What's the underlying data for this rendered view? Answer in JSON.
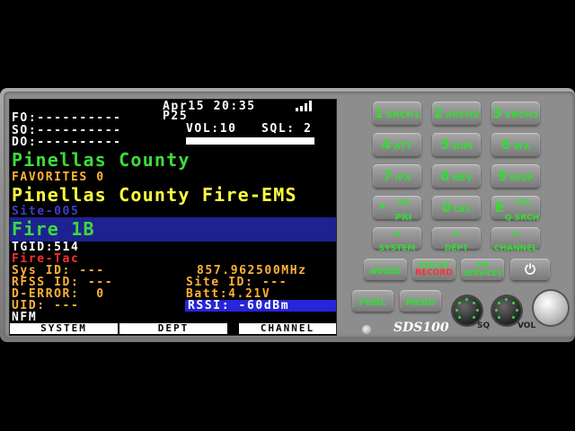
{
  "device": {
    "brand": "SDS100"
  },
  "status": {
    "date": "Apr15",
    "time": "20:35",
    "mode": "P25",
    "fo": "FO:----------",
    "so": "SO:----------",
    "do": "DO:----------",
    "volume": "VOL:10",
    "squelch": "SQL: 2"
  },
  "scan": {
    "system": "Pinellas County",
    "favorites": "FAVORITES 0",
    "department": "Pinellas County Fire-EMS",
    "site": "Site-005",
    "channel": "Fire 1B",
    "tgid": "TGID:514",
    "service_type": "Fire-Tac"
  },
  "details": {
    "sys_id": "Sys ID: ---",
    "frequency": "857.962500MHz",
    "rfss_id": "RFSS ID: ---",
    "site_id": "Site ID: ---",
    "d_error": "D-ERROR:  0",
    "battery": "Batt:4.21V",
    "uid": "UID: ---",
    "rssi": "RSSI: -60dBm",
    "modulation": "NFM"
  },
  "softkeys": [
    "SYSTEM",
    "DEPT",
    "CHANNEL"
  ],
  "keypad": [
    {
      "key": "1",
      "label": "SRCH1"
    },
    {
      "key": "2",
      "label": "SRCH2"
    },
    {
      "key": "3",
      "label": "SRCH3"
    },
    {
      "key": "4",
      "label": "ATT"
    },
    {
      "key": "5",
      "label": "DIM"
    },
    {
      "key": "6",
      "label": "WX"
    },
    {
      "key": "7",
      "label": "IFX"
    },
    {
      "key": "8",
      "label": "REV"
    },
    {
      "key": "9",
      "label": "DISP"
    },
    {
      "key": "•",
      "label": "PRI",
      "sub": "NO"
    },
    {
      "key": "0",
      "label": "LVL"
    },
    {
      "key": "E",
      "label": "Q SRCH",
      "sub": "YES"
    }
  ],
  "system_keys": [
    "SYSTEM",
    "DEPT",
    "CHANNEL"
  ],
  "controls": {
    "avoid": "AVOID",
    "replay": "REPLAY",
    "record": "RECORD",
    "zip": "ZIP",
    "services": "SERVICES",
    "power": "⏻",
    "func": "FUNC",
    "menu": "MENU",
    "sq_label": "SQ",
    "vol_label": "VOL"
  }
}
